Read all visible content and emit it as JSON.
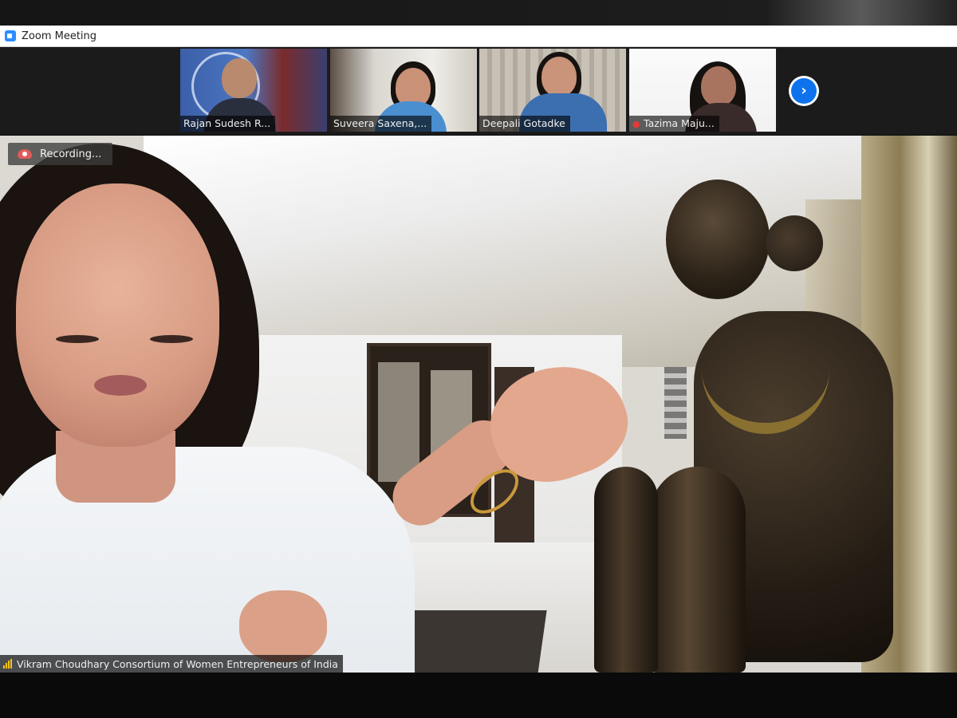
{
  "window": {
    "title": "Zoom Meeting"
  },
  "participants_strip": {
    "tiles": [
      {
        "name": "Rajan Sudesh R...",
        "muted": false
      },
      {
        "name": "Suveera Saxena,...",
        "muted": false
      },
      {
        "name": "Deepali Gotadke",
        "muted": false
      },
      {
        "name": "Tazima Maju...",
        "muted": true
      }
    ],
    "next_button_icon": "chevron-right-icon",
    "next_glyph": "›"
  },
  "recording": {
    "label": "Recording...",
    "icon": "cloud-record-icon"
  },
  "active_speaker": {
    "label": "Vikram Choudhary  Consortium of Women Entrepreneurs of India",
    "icon": "connection-signal-icon"
  },
  "colors": {
    "accent": "#0e72ed",
    "titlebar_bg": "#ffffff",
    "strip_bg": "#1b1b1b",
    "muted_mic": "#e53935",
    "signal": "#f5c518"
  }
}
